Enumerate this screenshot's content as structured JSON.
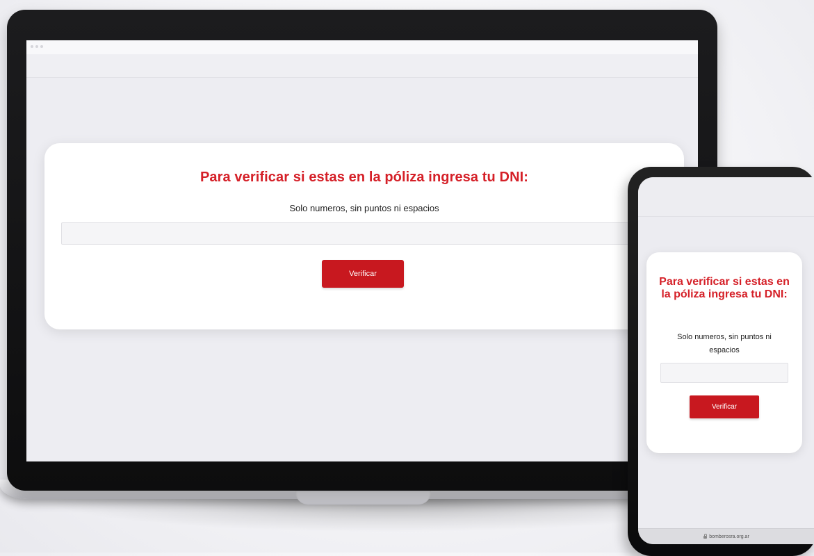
{
  "form": {
    "title": "Para verificar si estas en la póliza ingresa tu DNI:",
    "instructions": "Solo numeros, sin puntos ni espacios",
    "dni_value": "",
    "dni_placeholder": "",
    "submit_label": "Verificar"
  },
  "mobile_browser": {
    "url": "bomberosra.org.ar",
    "lock_icon": "lock-icon"
  },
  "colors": {
    "accent": "#d52028",
    "button": "#c8181f",
    "card_background": "#ffffff",
    "page_background": "#ededf2"
  }
}
